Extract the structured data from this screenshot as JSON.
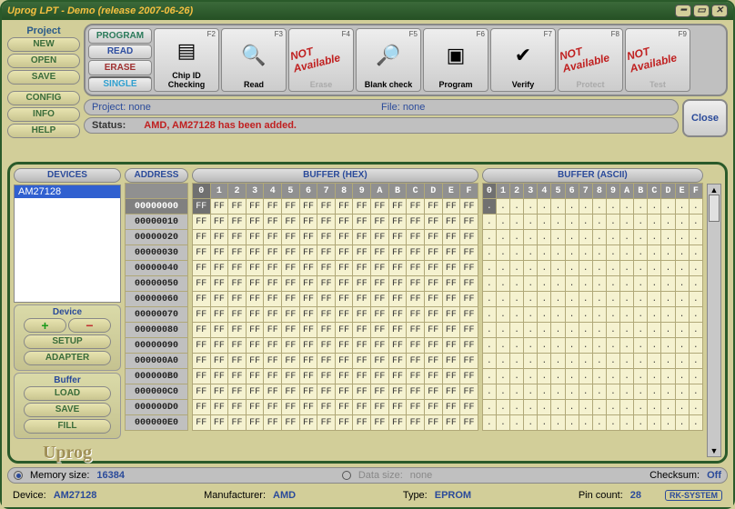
{
  "window": {
    "title": "Uprog LPT - Demo (release 2007-06-26)"
  },
  "project_buttons": {
    "header": "Project",
    "new": "NEW",
    "open": "OPEN",
    "save": "SAVE"
  },
  "left_buttons": {
    "config": "CONFIG",
    "info": "INFO",
    "help": "HELP"
  },
  "modes": {
    "program": "PROGRAM",
    "read": "READ",
    "erase": "ERASE",
    "single": "SINGLE"
  },
  "toolbar": [
    {
      "fkey": "F2",
      "label": "Chip ID Checking",
      "na": false
    },
    {
      "fkey": "F3",
      "label": "Read",
      "na": false
    },
    {
      "fkey": "F4",
      "label": "Erase",
      "na": true
    },
    {
      "fkey": "F5",
      "label": "Blank check",
      "na": false
    },
    {
      "fkey": "F6",
      "label": "Program",
      "na": false
    },
    {
      "fkey": "F7",
      "label": "Verify",
      "na": false
    },
    {
      "fkey": "F8",
      "label": "Protect",
      "na": true
    },
    {
      "fkey": "F9",
      "label": "Test",
      "na": true
    }
  ],
  "na_text": "NOT Available",
  "close_label": "Close",
  "fields": {
    "project_label": "Project:",
    "project_value": "none",
    "file_label": "File:",
    "file_value": "none",
    "status_label": "Status:",
    "status_value": "AMD, AM27128 has been added."
  },
  "panels": {
    "devices": "DEVICES",
    "address": "ADDRESS",
    "buffer_hex": "BUFFER (HEX)",
    "buffer_ascii": "BUFFER (ASCII)"
  },
  "device_list": [
    "AM27128"
  ],
  "device_panel": {
    "header": "Device",
    "setup": "SETUP",
    "adapter": "ADAPTER"
  },
  "buffer_panel": {
    "header": "Buffer",
    "load": "LOAD",
    "save": "SAVE",
    "fill": "FILL"
  },
  "logo": "Uprog",
  "hex": {
    "columns": [
      "0",
      "1",
      "2",
      "3",
      "4",
      "5",
      "6",
      "7",
      "8",
      "9",
      "A",
      "B",
      "C",
      "D",
      "E",
      "F"
    ],
    "addresses": [
      "00000000",
      "00000010",
      "00000020",
      "00000030",
      "00000040",
      "00000050",
      "00000060",
      "00000070",
      "00000080",
      "00000090",
      "000000A0",
      "000000B0",
      "000000C0",
      "000000D0",
      "000000E0"
    ],
    "byte": "FF",
    "ascii": "."
  },
  "footer1": {
    "memsize_label": "Memory size:",
    "memsize_value": "16384",
    "datasize_label": "Data size:",
    "datasize_value": "none",
    "checksum_label": "Checksum:",
    "checksum_value": "Off"
  },
  "footer2": {
    "device_label": "Device:",
    "device_value": "AM27128",
    "manuf_label": "Manufacturer:",
    "manuf_value": "AMD",
    "type_label": "Type:",
    "type_value": "EPROM",
    "pins_label": "Pin count:",
    "pins_value": "28",
    "brand": "RK-SYSTEM"
  }
}
